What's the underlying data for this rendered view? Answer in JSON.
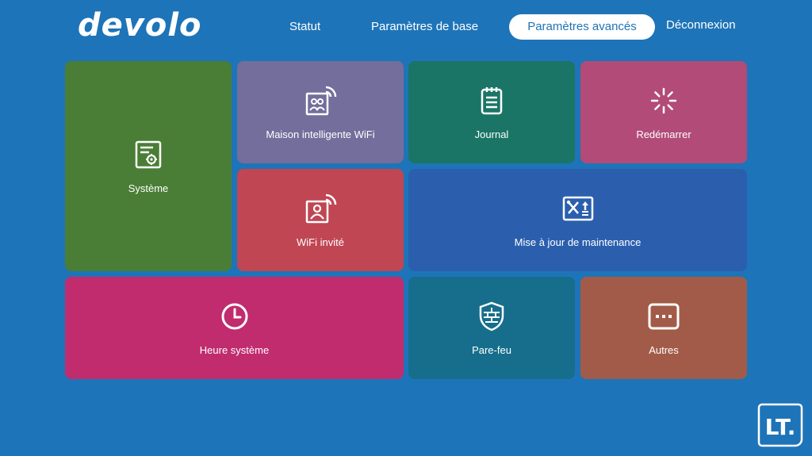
{
  "brand": {
    "logo_text": "devolo"
  },
  "nav": {
    "statut": "Statut",
    "parametres_base": "Paramètres de base",
    "parametres_avances": "Paramètres avancés",
    "deconnexion": "Déconnexion"
  },
  "tiles": {
    "systeme": {
      "label": "Système",
      "icon": "settings-document-icon"
    },
    "maison": {
      "label": "Maison intelligente WiFi",
      "icon": "smart-home-wifi-icon"
    },
    "journal": {
      "label": "Journal",
      "icon": "clipboard-icon"
    },
    "redemarrer": {
      "label": "Redémarrer",
      "icon": "loading-spinner-icon"
    },
    "wifi_invite": {
      "label": "WiFi invité",
      "icon": "guest-wifi-icon"
    },
    "maintenance": {
      "label": "Mise à jour de maintenance",
      "icon": "tools-update-icon"
    },
    "heure": {
      "label": "Heure système",
      "icon": "clock-icon"
    },
    "parefeu": {
      "label": "Pare-feu",
      "icon": "firewall-shield-icon"
    },
    "autres": {
      "label": "Autres",
      "icon": "more-dots-icon"
    }
  },
  "watermark": {
    "text": "LT."
  },
  "colors": {
    "background": "#1e74b8",
    "systeme": "#4a7e36",
    "maison": "#736e9b",
    "journal": "#1a7566",
    "redemarrer": "#b24b78",
    "wifi_invite": "#c04653",
    "maintenance": "#2b5fae",
    "heure": "#c02c6e",
    "parefeu": "#166e8c",
    "autres": "#a25b48"
  }
}
